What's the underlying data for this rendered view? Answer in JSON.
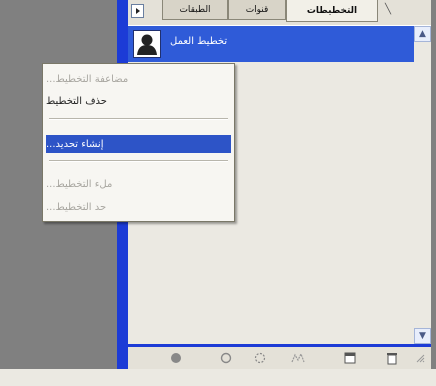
{
  "panel": {
    "tabs": [
      {
        "label": "الطبقات",
        "active": false
      },
      {
        "label": "قنوات",
        "active": false
      },
      {
        "label": "التخطيطات",
        "active": true
      }
    ],
    "path_item": {
      "name": "تخطيط العمل"
    }
  },
  "context_menu": {
    "items": [
      {
        "label": "مضاعفة التخطيط...",
        "state": "disabled"
      },
      {
        "label": "حذف التخطيط",
        "state": "enabled"
      },
      {
        "label": "إنشاء تحديد...",
        "state": "selected"
      },
      {
        "label": "ملء التخطيط...",
        "state": "disabled"
      },
      {
        "label": "حد التخطيط...",
        "state": "disabled"
      }
    ]
  },
  "footer": {
    "icons": [
      "fill-path-icon",
      "stroke-path-icon",
      "load-selection-icon",
      "make-work-path-icon",
      "new-path-icon",
      "delete-path-icon"
    ]
  },
  "colors": {
    "selection": "#2d54c7",
    "panel_frame": "#1c3bd6",
    "workspace": "#808080",
    "panel_bg": "#ebe9e2"
  }
}
